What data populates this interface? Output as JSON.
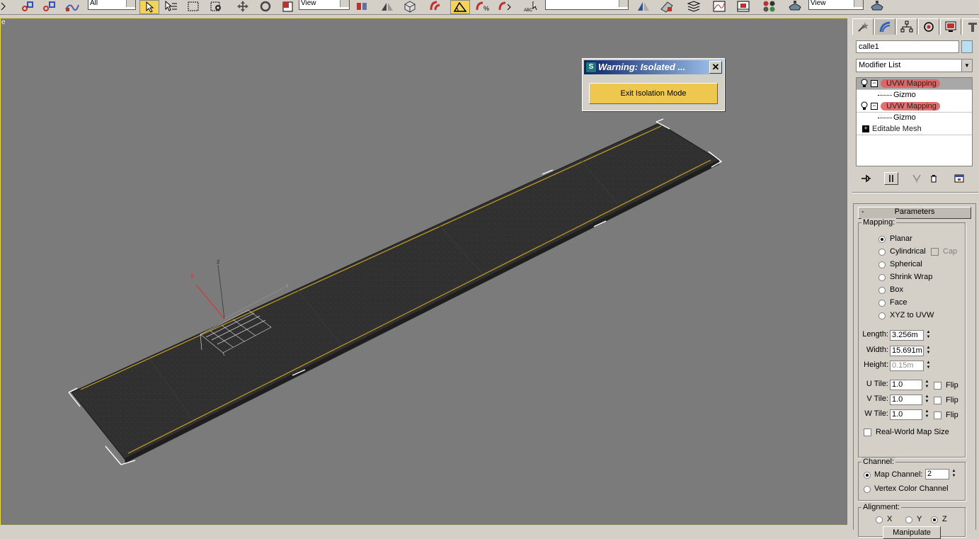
{
  "toolbar": {
    "selection_filter": "All",
    "ref_coord_1": "View",
    "ref_coord_2": "View",
    "icons": [
      "link-icon",
      "unlink-icon",
      "bind-space-warp-icon",
      "select-object-icon",
      "select-by-name-icon",
      "rect-selection-icon",
      "window-crossing-icon",
      "move-icon",
      "rotate-icon",
      "scale-icon",
      "pivot-icon",
      "mirror-icon",
      "align-icon",
      "snaps-toggle-icon",
      "angle-snap-icon",
      "percent-snap-icon",
      "spinner-snap-icon",
      "edit-named-sel-icon",
      "layer-manager-icon",
      "curve-editor-icon",
      "schematic-icon",
      "material-editor-icon",
      "render-setup-icon",
      "render-icon"
    ]
  },
  "viewport": {
    "label": "e",
    "axis_labels": {
      "x": "x",
      "y": "y",
      "z": "z"
    },
    "colors": {
      "background": "#7b7b7b",
      "border": "#e8d84a",
      "road": "#2f302f",
      "line": "#c8a020"
    }
  },
  "dialog": {
    "title": "Warning: Isolated ...",
    "close_label": "✕",
    "button_label": "Exit Isolation Mode",
    "button_color": "#eec84e"
  },
  "panel": {
    "object_name": "calle1",
    "modifier_list": "Modifier List",
    "stack": [
      {
        "label": "UVW Mapping",
        "sub": "Gizmo",
        "selected": true
      },
      {
        "label": "UVW Mapping",
        "sub": "Gizmo",
        "selected": false
      },
      {
        "label": "Editable Mesh"
      }
    ],
    "rollout_title": "Parameters",
    "rollout_toggle": "-",
    "mapping": {
      "label": "Mapping:",
      "options": [
        "Planar",
        "Cylindrical",
        "Spherical",
        "Shrink Wrap",
        "Box",
        "Face",
        "XYZ to UVW"
      ],
      "selected": "Planar",
      "cap_label": "Cap",
      "length_label": "Length:",
      "length": "3.256m",
      "width_label": "Width:",
      "width": "15.691m",
      "height_label": "Height:",
      "height": "0.15m",
      "u_tile_label": "U Tile:",
      "u_tile": "1.0",
      "v_tile_label": "V Tile:",
      "v_tile": "1.0",
      "w_tile_label": "W Tile:",
      "w_tile": "1.0",
      "flip_label": "Flip",
      "real_world_label": "Real-World Map Size"
    },
    "channel": {
      "label": "Channel:",
      "map_channel_label": "Map Channel:",
      "map_channel": "2",
      "vertex_color_label": "Vertex Color Channel"
    },
    "alignment": {
      "label": "Alignment:",
      "x": "X",
      "y": "Y",
      "z": "Z",
      "selected": "Z",
      "manipulate": "Manipulate"
    }
  }
}
